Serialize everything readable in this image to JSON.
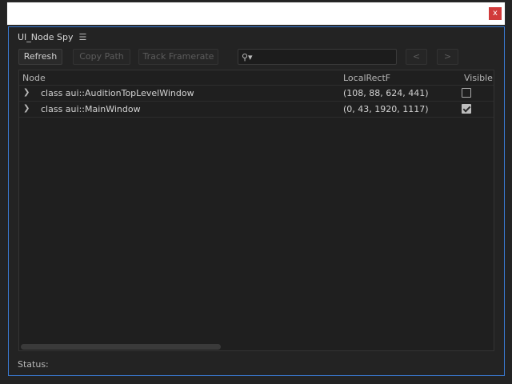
{
  "window": {
    "close_label": "x"
  },
  "panel": {
    "title": "UI_Node Spy",
    "menu_icon": "hamburger-menu-icon"
  },
  "toolbar": {
    "refresh_label": "Refresh",
    "copy_path_label": "Copy Path",
    "track_framerate_label": "Track Framerate",
    "search_placeholder": "",
    "search_icon": "search-icon",
    "prev_label": "<",
    "next_label": ">"
  },
  "tree": {
    "columns": [
      "Node",
      "LocalRectF",
      "Visible"
    ],
    "rows": [
      {
        "node": "class aui::AuditionTopLevelWindow",
        "rect": "(108, 88, 624, 441)",
        "visible": false
      },
      {
        "node": "class aui::MainWindow",
        "rect": "(0, 43, 1920, 1117)",
        "visible": true
      }
    ]
  },
  "status": {
    "label": "Status:"
  }
}
